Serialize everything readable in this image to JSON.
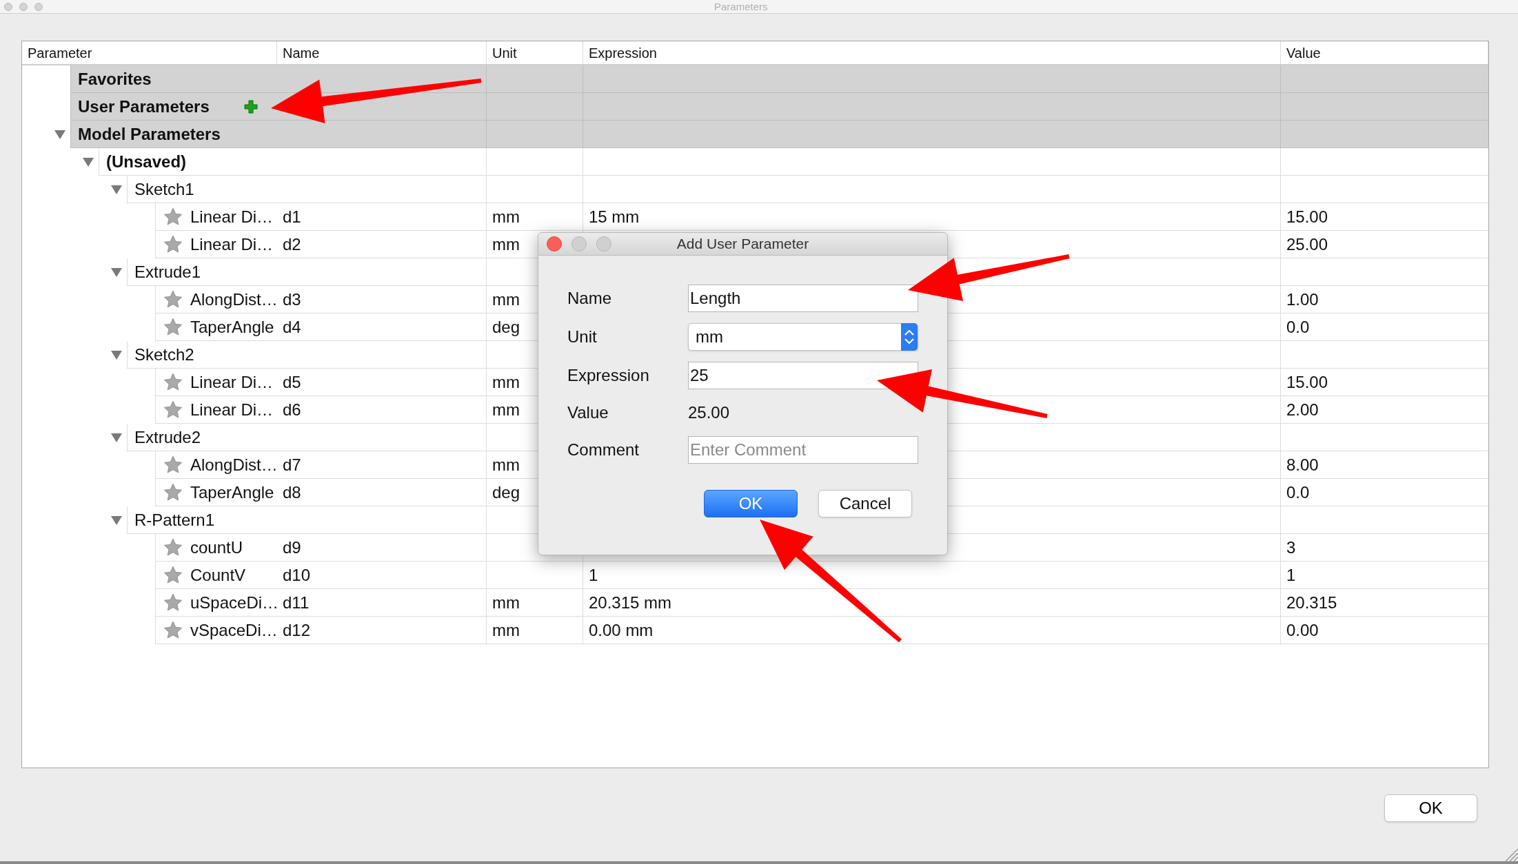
{
  "window": {
    "title": "Parameters"
  },
  "table": {
    "columns": [
      "Parameter",
      "Name",
      "Unit",
      "Expression",
      "Value"
    ],
    "rows": [
      {
        "kind": "section",
        "label": "Favorites"
      },
      {
        "kind": "section",
        "label": "User Parameters",
        "add_icon": true
      },
      {
        "kind": "section",
        "label": "Model Parameters",
        "expanded": true,
        "children": [
          {
            "kind": "document",
            "label": "(Unsaved)",
            "expanded": true,
            "children": [
              {
                "kind": "feature",
                "label": "Sketch1",
                "expanded": true,
                "children": [
                  {
                    "kind": "parameter",
                    "label": "Linear Di…",
                    "name": "d1",
                    "unit": "mm",
                    "expression": "15 mm",
                    "value": "15.00"
                  },
                  {
                    "kind": "parameter",
                    "label": "Linear Di…",
                    "name": "d2",
                    "unit": "mm",
                    "value": "25.00"
                  }
                ]
              },
              {
                "kind": "feature",
                "label": "Extrude1",
                "expanded": true,
                "children": [
                  {
                    "kind": "parameter",
                    "label": "AlongDist…",
                    "name": "d3",
                    "unit": "mm",
                    "value": "1.00"
                  },
                  {
                    "kind": "parameter",
                    "label": "TaperAngle",
                    "name": "d4",
                    "unit": "deg",
                    "value": "0.0"
                  }
                ]
              },
              {
                "kind": "feature",
                "label": "Sketch2",
                "expanded": true,
                "children": [
                  {
                    "kind": "parameter",
                    "label": "Linear Di…",
                    "name": "d5",
                    "unit": "mm",
                    "value": "15.00"
                  },
                  {
                    "kind": "parameter",
                    "label": "Linear Di…",
                    "name": "d6",
                    "unit": "mm",
                    "value": "2.00"
                  }
                ]
              },
              {
                "kind": "feature",
                "label": "Extrude2",
                "expanded": true,
                "children": [
                  {
                    "kind": "parameter",
                    "label": "AlongDist…",
                    "name": "d7",
                    "unit": "mm",
                    "value": "8.00"
                  },
                  {
                    "kind": "parameter",
                    "label": "TaperAngle",
                    "name": "d8",
                    "unit": "deg",
                    "value": "0.0"
                  }
                ]
              },
              {
                "kind": "feature",
                "label": "R-Pattern1",
                "expanded": true,
                "children": [
                  {
                    "kind": "parameter",
                    "label": "countU",
                    "name": "d9",
                    "value": "3"
                  },
                  {
                    "kind": "parameter",
                    "label": "CountV",
                    "name": "d10",
                    "expression": "1",
                    "value": "1"
                  },
                  {
                    "kind": "parameter",
                    "label": "uSpaceDi…",
                    "name": "d11",
                    "unit": "mm",
                    "expression": "20.315 mm",
                    "value": "20.315"
                  },
                  {
                    "kind": "parameter",
                    "label": "vSpaceDi…",
                    "name": "d12",
                    "unit": "mm",
                    "expression": "0.00 mm",
                    "value": "0.00"
                  }
                ]
              }
            ]
          }
        ]
      }
    ]
  },
  "dialog": {
    "title": "Add User Parameter",
    "fields": [
      {
        "kind": "text",
        "label": "Name",
        "value": "Length"
      },
      {
        "kind": "select",
        "label": "Unit",
        "value": "mm"
      },
      {
        "kind": "text",
        "label": "Expression",
        "value": "25"
      },
      {
        "kind": "readout",
        "label": "Value",
        "value": "25.00"
      },
      {
        "kind": "text",
        "label": "Comment",
        "placeholder": "Enter Comment"
      }
    ],
    "buttons": [
      {
        "label": "OK",
        "default": true
      },
      {
        "label": "Cancel",
        "default": false
      }
    ]
  },
  "footer": {
    "button": "OK"
  }
}
